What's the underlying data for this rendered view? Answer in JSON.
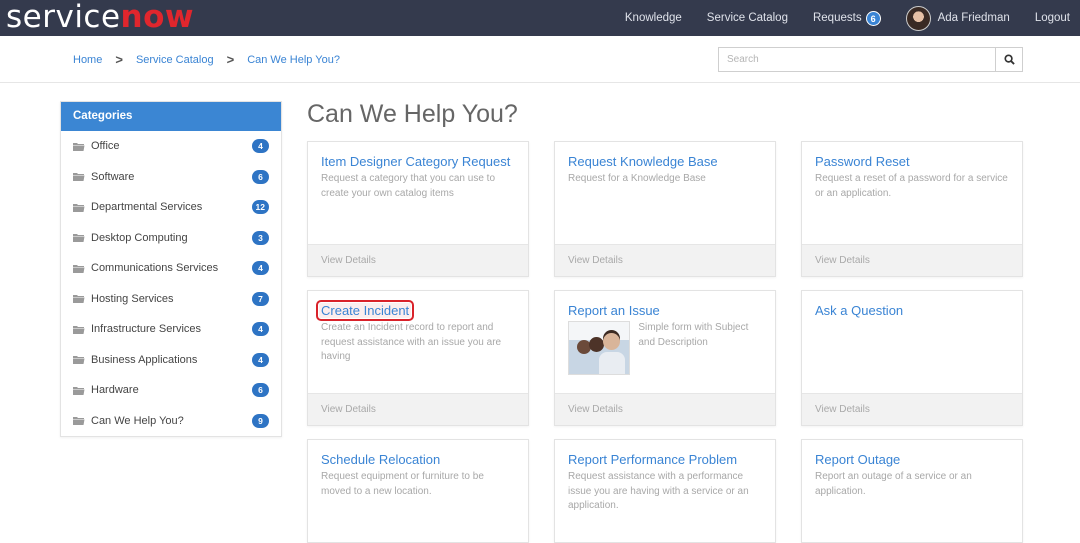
{
  "header": {
    "logo_part1": "service",
    "logo_part2": "now",
    "nav": {
      "knowledge": "Knowledge",
      "service_catalog": "Service Catalog",
      "requests": "Requests",
      "requests_count": "6",
      "user_name": "Ada Friedman",
      "logout": "Logout"
    }
  },
  "breadcrumb": {
    "items": [
      "Home",
      "Service Catalog",
      "Can We Help You?"
    ],
    "separator": ">"
  },
  "search": {
    "placeholder": "Search",
    "value": ""
  },
  "sidebar": {
    "title": "Categories",
    "items": [
      {
        "label": "Office",
        "count": "4"
      },
      {
        "label": "Software",
        "count": "6"
      },
      {
        "label": "Departmental Services",
        "count": "12"
      },
      {
        "label": "Desktop Computing",
        "count": "3"
      },
      {
        "label": "Communications Services",
        "count": "4"
      },
      {
        "label": "Hosting Services",
        "count": "7"
      },
      {
        "label": "Infrastructure Services",
        "count": "4"
      },
      {
        "label": "Business Applications",
        "count": "4"
      },
      {
        "label": "Hardware",
        "count": "6"
      },
      {
        "label": "Can We Help You?",
        "count": "9"
      }
    ]
  },
  "main": {
    "title": "Can We Help You?",
    "view_details_label": "View Details",
    "cards": [
      {
        "title": "Item Designer Category Request",
        "desc": "Request a category that you can use to create your own catalog items"
      },
      {
        "title": "Request Knowledge Base",
        "desc": "Request for a Knowledge Base"
      },
      {
        "title": "Password Reset",
        "desc": "Request a reset of a password for a service or an application."
      },
      {
        "title": "Create Incident",
        "desc": "Create an Incident record to report and request assistance with an issue you are having"
      },
      {
        "title": "Report an Issue",
        "desc": "Simple form with Subject and Description"
      },
      {
        "title": "Ask a Question",
        "desc": ""
      },
      {
        "title": "Schedule Relocation",
        "desc": "Request equipment or furniture to be moved to a new location."
      },
      {
        "title": "Report Performance Problem",
        "desc": "Request assistance with a performance issue you are having with a service or an application."
      },
      {
        "title": "Report Outage",
        "desc": "Report an outage of a service or an application."
      }
    ]
  },
  "colors": {
    "header_bg": "#343a4d",
    "brand_red": "#e0262d",
    "accent_blue": "#3a84d4",
    "highlight_outline": "#d9222a"
  }
}
